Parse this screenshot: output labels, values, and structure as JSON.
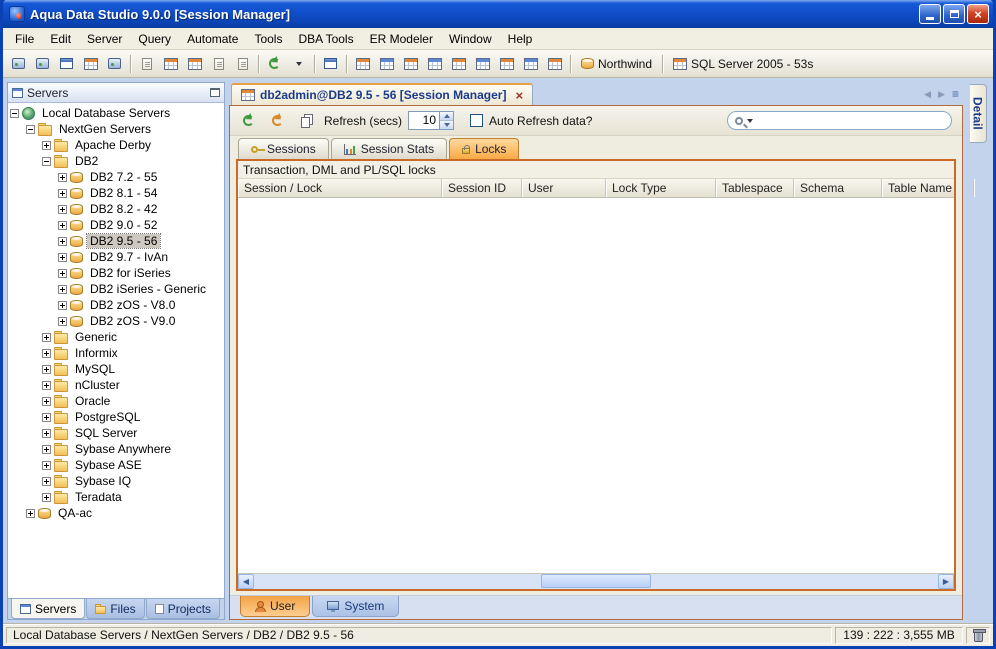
{
  "window": {
    "title": "Aqua Data Studio 9.0.0 [Session Manager]"
  },
  "glyphs": {
    "close": "×",
    "nav_left": "◀",
    "nav_right": "▶",
    "tab_list": "≡"
  },
  "menu": {
    "items": [
      "File",
      "Edit",
      "Server",
      "Query",
      "Automate",
      "Tools",
      "DBA Tools",
      "ER Modeler",
      "Window",
      "Help"
    ]
  },
  "toolbar": {
    "groups": [
      [
        {
          "n": "register-server",
          "t": "server"
        },
        {
          "n": "connect-server",
          "t": "server"
        },
        {
          "n": "server-window",
          "t": "window"
        },
        {
          "n": "schema-browser",
          "t": "grid"
        },
        {
          "n": "server-properties",
          "t": "server"
        }
      ],
      [
        {
          "n": "query-analyzer",
          "t": "doc"
        },
        {
          "n": "query-builder",
          "t": "grid"
        },
        {
          "n": "edit-table-data",
          "t": "grid"
        },
        {
          "n": "import-data",
          "t": "doc"
        },
        {
          "n": "export-data",
          "t": "doc"
        }
      ],
      [
        {
          "n": "schedule",
          "t": "refresh"
        },
        {
          "n": "schedule-dropdown",
          "t": "caret"
        }
      ],
      [
        {
          "n": "new-window",
          "t": "window"
        }
      ],
      [
        {
          "n": "grid-results",
          "t": "grid"
        },
        {
          "n": "pivot-grid",
          "t": "grid-blue"
        },
        {
          "n": "form-view",
          "t": "grid"
        },
        {
          "n": "chart-view",
          "t": "grid-blue"
        },
        {
          "n": "table-designer",
          "t": "grid"
        },
        {
          "n": "view-designer",
          "t": "grid-blue"
        },
        {
          "n": "er-diagram",
          "t": "grid"
        },
        {
          "n": "procedure-editor",
          "t": "grid-blue"
        },
        {
          "n": "session-manager",
          "t": "grid"
        }
      ]
    ],
    "database": "Northwind",
    "server": "SQL Server 2005 - 53s"
  },
  "sidebar": {
    "title": "Servers",
    "tabs": [
      {
        "label": "Servers"
      },
      {
        "label": "Files"
      },
      {
        "label": "Projects"
      }
    ],
    "tree": [
      {
        "label": "Local Database Servers",
        "depth": 0,
        "exp": "-",
        "icon": "root"
      },
      {
        "label": "NextGen Servers",
        "depth": 1,
        "exp": "-",
        "icon": "folder"
      },
      {
        "label": "Apache Derby",
        "depth": 2,
        "exp": "+",
        "icon": "folder"
      },
      {
        "label": "DB2",
        "depth": 2,
        "exp": "-",
        "icon": "folder"
      },
      {
        "label": "DB2 7.2 - 55",
        "depth": 3,
        "exp": "+",
        "icon": "db"
      },
      {
        "label": "DB2 8.1 - 54",
        "depth": 3,
        "exp": "+",
        "icon": "db"
      },
      {
        "label": "DB2 8.2 - 42",
        "depth": 3,
        "exp": "+",
        "icon": "db"
      },
      {
        "label": "DB2 9.0 - 52",
        "depth": 3,
        "exp": "+",
        "icon": "db"
      },
      {
        "label": "DB2 9.5 - 56",
        "depth": 3,
        "exp": "+",
        "icon": "db",
        "sel": true
      },
      {
        "label": "DB2 9.7 - IvAn",
        "depth": 3,
        "exp": "+",
        "icon": "db"
      },
      {
        "label": "DB2 for iSeries",
        "depth": 3,
        "exp": "+",
        "icon": "db"
      },
      {
        "label": "DB2 iSeries - Generic",
        "depth": 3,
        "exp": "+",
        "icon": "db"
      },
      {
        "label": "DB2 zOS - V8.0",
        "depth": 3,
        "exp": "+",
        "icon": "db"
      },
      {
        "label": "DB2 zOS - V9.0",
        "depth": 3,
        "exp": "+",
        "icon": "db"
      },
      {
        "label": "Generic",
        "depth": 2,
        "exp": "+",
        "icon": "folder"
      },
      {
        "label": "Informix",
        "depth": 2,
        "exp": "+",
        "icon": "folder"
      },
      {
        "label": "MySQL",
        "depth": 2,
        "exp": "+",
        "icon": "folder"
      },
      {
        "label": "nCluster",
        "depth": 2,
        "exp": "+",
        "icon": "folder"
      },
      {
        "label": "Oracle",
        "depth": 2,
        "exp": "+",
        "icon": "folder"
      },
      {
        "label": "PostgreSQL",
        "depth": 2,
        "exp": "+",
        "icon": "folder"
      },
      {
        "label": "SQL Server",
        "depth": 2,
        "exp": "+",
        "icon": "folder"
      },
      {
        "label": "Sybase Anywhere",
        "depth": 2,
        "exp": "+",
        "icon": "folder"
      },
      {
        "label": "Sybase ASE",
        "depth": 2,
        "exp": "+",
        "icon": "folder"
      },
      {
        "label": "Sybase IQ",
        "depth": 2,
        "exp": "+",
        "icon": "folder"
      },
      {
        "label": "Teradata",
        "depth": 2,
        "exp": "+",
        "icon": "folder"
      },
      {
        "label": "QA-ac",
        "depth": 1,
        "exp": "+",
        "icon": "db"
      }
    ]
  },
  "main": {
    "doc_tab": "db2admin@DB2 9.5 - 56 [Session Manager]",
    "refresh_label": "Refresh (secs)",
    "refresh_value": "10",
    "auto_refresh_label": "Auto Refresh data?",
    "tabs": [
      "Sessions",
      "Session Stats",
      "Locks"
    ],
    "locks_caption": "Transaction, DML and PL/SQL locks",
    "columns": [
      "Session / Lock",
      "Session ID",
      "User",
      "Lock Type",
      "Tablespace",
      "Schema",
      "Table Name"
    ],
    "bottom_tabs": [
      "User",
      "System"
    ]
  },
  "detail": {
    "label": "Detail"
  },
  "statusbar": {
    "path": "Local Database Servers / NextGen Servers / DB2 / DB2 9.5 - 56",
    "memory": "139 : 222 : 3,555 MB"
  }
}
